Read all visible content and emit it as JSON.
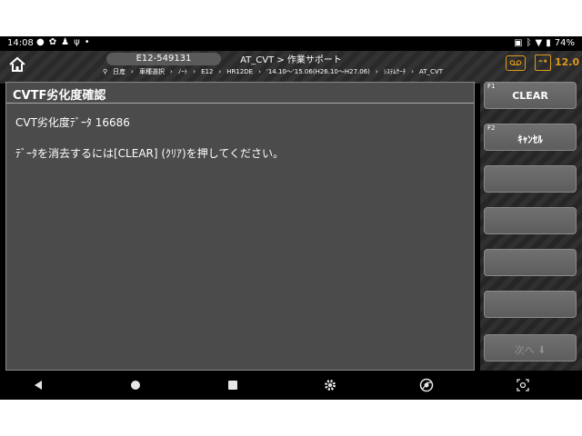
{
  "status_bar": {
    "time": "14:08",
    "battery_percent": "74%"
  },
  "header": {
    "vin": "E12-549131",
    "title": "AT_CVT > 作業サポート",
    "breadcrumb": [
      "日産",
      "車種選択",
      "ﾉｰﾄ",
      "E12",
      "HR12DE",
      "'14.10～'15.06(H26.10～H27.06)",
      "ｼｽﾃﾑｻｰﾁ",
      "AT_CVT"
    ],
    "voltage": "12.0"
  },
  "panel": {
    "title": "CVTF劣化度確認",
    "line1": "CVT劣化度ﾃﾞｰﾀ 16686",
    "line2": "ﾃﾞｰﾀを消去するには[CLEAR] (ｸﾘｱ)を押してください。"
  },
  "function_keys": [
    {
      "label": "F1",
      "text": "CLEAR"
    },
    {
      "label": "F2",
      "text": "ｷｬﾝｾﾙ"
    },
    {
      "label": "",
      "text": ""
    },
    {
      "label": "",
      "text": ""
    },
    {
      "label": "",
      "text": ""
    },
    {
      "label": "",
      "text": ""
    },
    {
      "label": "",
      "text": "次へ ⬇"
    }
  ],
  "colors": {
    "accent": "#e09a1a",
    "panel_bg": "#4b4b4b",
    "button_bg": "#666666"
  }
}
